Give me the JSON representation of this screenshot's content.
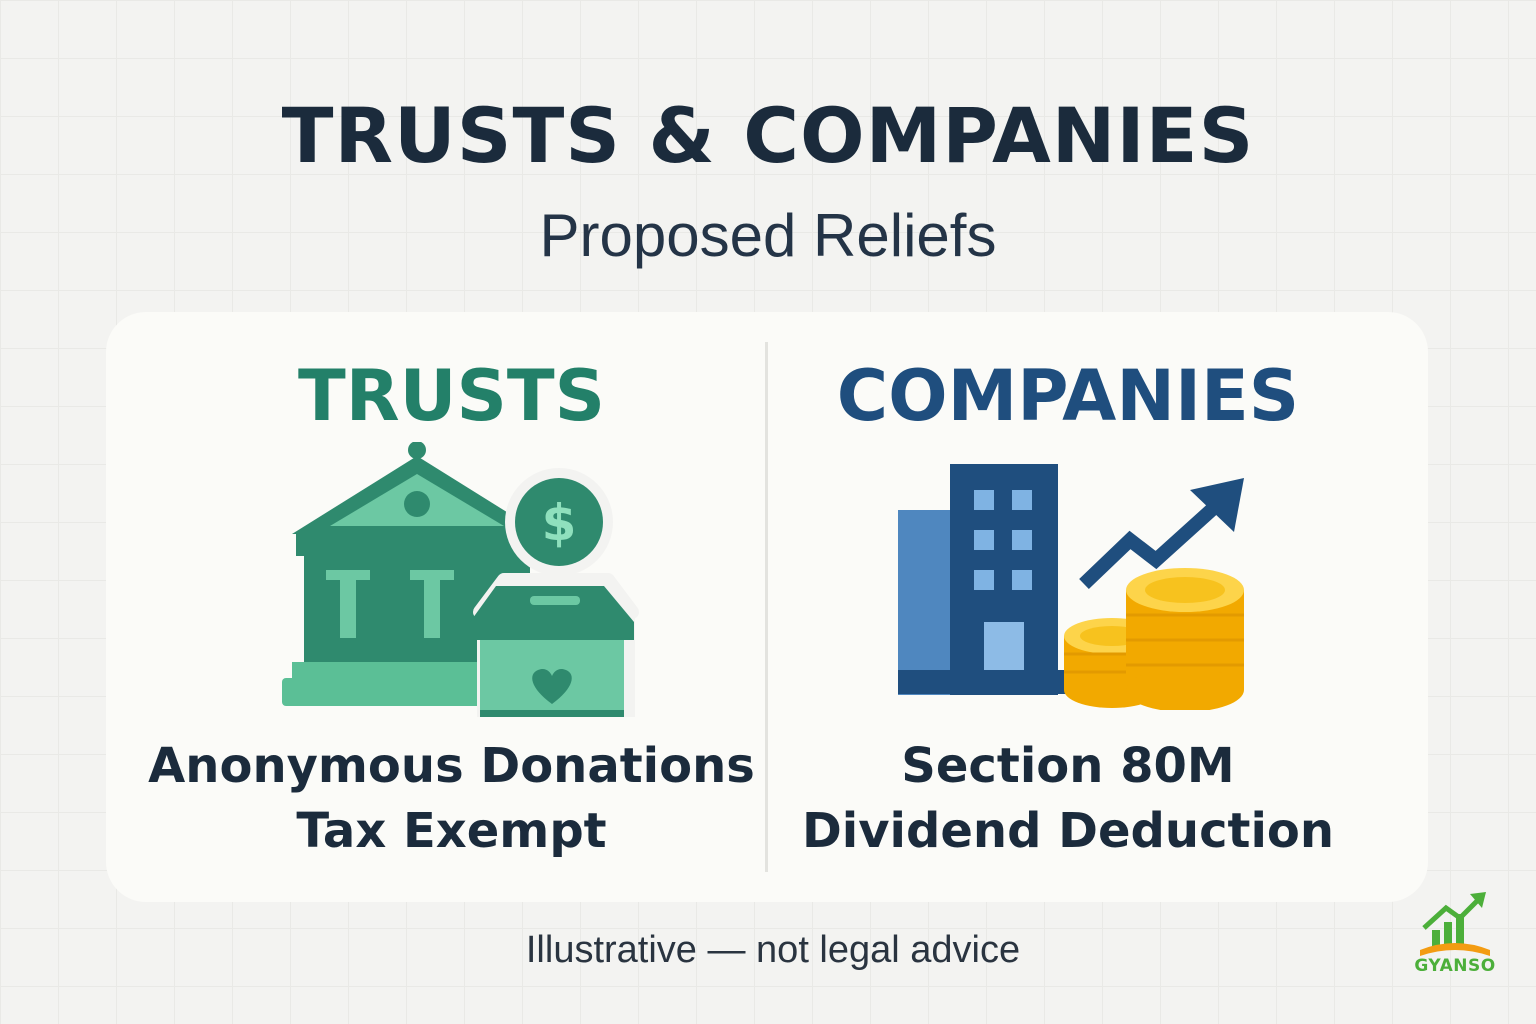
{
  "header": {
    "title": "TRUSTS & COMPANIES",
    "subtitle": "Proposed Reliefs"
  },
  "panels": {
    "trusts": {
      "heading": "TRUSTS",
      "caption_line1": "Anonymous Donations",
      "caption_line2": "Tax Exempt",
      "icon_name": "bank-donation-box-icon",
      "accent": "#238069"
    },
    "companies": {
      "heading": "COMPANIES",
      "caption_line1": "Section 80M",
      "caption_line2": "Dividend Deduction",
      "icon_name": "building-coins-growth-icon",
      "accent": "#1f4e7e"
    }
  },
  "footer": {
    "disclaimer": "Illustrative — not legal advice"
  },
  "brand": {
    "name": "GYANSO"
  },
  "colors": {
    "text": "#1b2b3c",
    "green": "#238069",
    "blue": "#1f4e7e",
    "coin": "#f7b813"
  }
}
